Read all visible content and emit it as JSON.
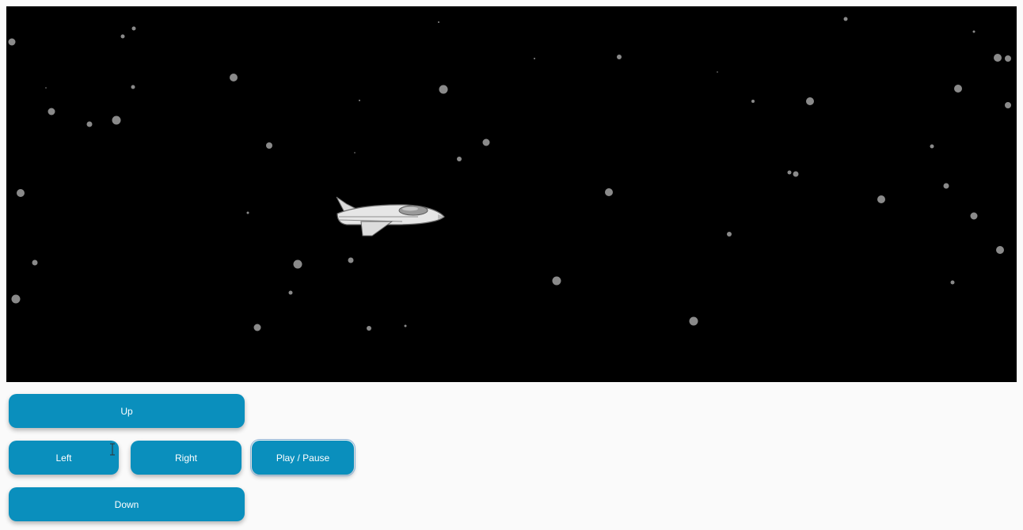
{
  "game": {
    "scene": "space-starfield",
    "background_color": "#000000",
    "star_color": "#8a8a8a",
    "ship": {
      "icon": "spaceship-icon"
    }
  },
  "controls": {
    "up_label": "Up",
    "left_label": "Left",
    "right_label": "Right",
    "play_pause_label": "Play / Pause",
    "down_label": "Down",
    "button_color": "#0a8fbd",
    "text_color": "#ffffff"
  }
}
